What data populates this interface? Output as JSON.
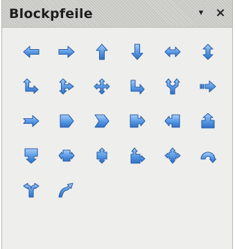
{
  "panel": {
    "title": "Blockpfeile",
    "menu_glyph": "▾",
    "close_glyph": "×"
  },
  "shape_color": "#5b9de6",
  "shapes": [
    {
      "icon": "left-arrow-icon"
    },
    {
      "icon": "right-arrow-icon"
    },
    {
      "icon": "up-arrow-icon"
    },
    {
      "icon": "down-arrow-icon"
    },
    {
      "icon": "left-right-arrow-icon"
    },
    {
      "icon": "up-down-arrow-icon"
    },
    {
      "icon": "up-right-arrow-icon"
    },
    {
      "icon": "up-right-down-arrow-icon"
    },
    {
      "icon": "four-way-arrow-icon"
    },
    {
      "icon": "corner-right-arrow-icon"
    },
    {
      "icon": "split-arrow-icon"
    },
    {
      "icon": "striped-right-arrow-icon"
    },
    {
      "icon": "notched-right-arrow-icon"
    },
    {
      "icon": "pentagon-icon"
    },
    {
      "icon": "chevron-icon"
    },
    {
      "icon": "right-arrow-callout-icon"
    },
    {
      "icon": "left-arrow-callout-icon"
    },
    {
      "icon": "up-arrow-callout-icon"
    },
    {
      "icon": "down-arrow-callout-icon"
    },
    {
      "icon": "left-right-arrow-callout-icon"
    },
    {
      "icon": "up-down-arrow-callout-icon"
    },
    {
      "icon": "up-right-arrow-callout-icon"
    },
    {
      "icon": "four-way-arrow-callout-icon"
    },
    {
      "icon": "circular-arrow-icon"
    },
    {
      "icon": "split-round-arrow-icon"
    },
    {
      "icon": "s-shaped-arrow-icon"
    }
  ]
}
